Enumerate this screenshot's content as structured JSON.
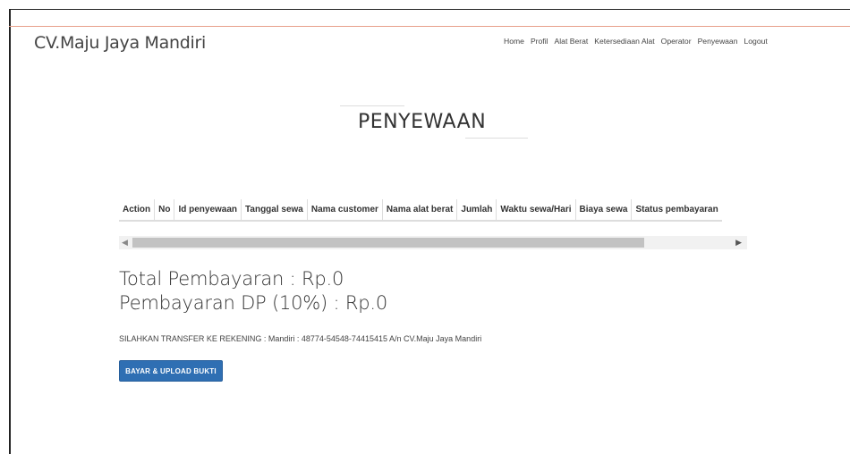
{
  "header": {
    "brand": "CV.Maju Jaya Mandiri",
    "nav": [
      "Home",
      "Profil",
      "Alat Berat",
      "Ketersediaan Alat",
      "Operator",
      "Penyewaan",
      "Logout"
    ]
  },
  "page": {
    "title": "PENYEWAAN"
  },
  "table": {
    "columns": [
      "Action",
      "No",
      "Id penyewaan",
      "Tanggal sewa",
      "Nama customer",
      "Nama alat berat",
      "Jumlah",
      "Waktu sewa/Hari",
      "Biaya sewa",
      "Status pembayaran"
    ]
  },
  "summary": {
    "total": "Total Pembayaran : Rp.0",
    "dp": "Pembayaran DP (10%) : Rp.0",
    "transfer_note": "SILAHKAN TRANSFER KE REKENING : Mandiri : 48774-54548-74415415 A/n CV.Maju Jaya Mandiri",
    "pay_button": "BAYAR & UPLOAD BUKTI"
  },
  "colors": {
    "button": "#2f6fb3",
    "topline": "#e8a08a"
  }
}
